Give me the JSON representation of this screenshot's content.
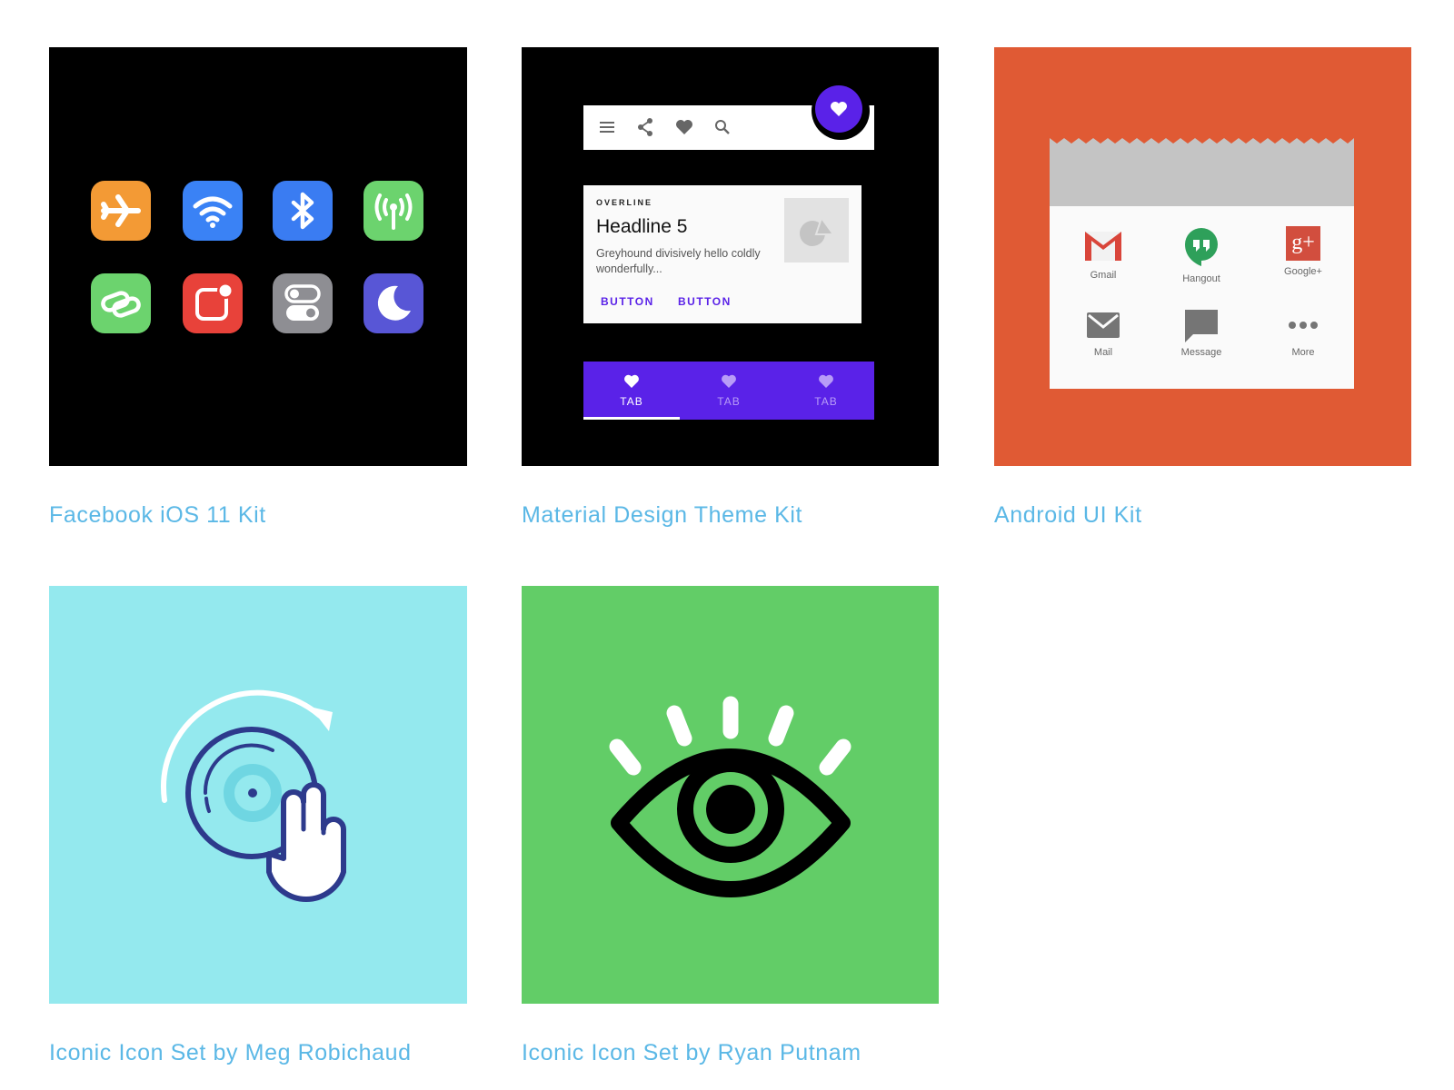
{
  "cards": [
    {
      "title": "Facebook iOS 11 Kit",
      "bg": "#000000"
    },
    {
      "title": "Material Design Theme Kit",
      "bg": "#000000"
    },
    {
      "title": "Android UI Kit",
      "bg": "#e05a34"
    },
    {
      "title": "Iconic Icon Set by Meg Robichaud",
      "bg": "#94e9ee"
    },
    {
      "title": "Iconic Icon Set by Ryan Putnam",
      "bg": "#62cd67"
    }
  ],
  "ios_icons": [
    {
      "name": "airplane-icon",
      "color": "#f39a35"
    },
    {
      "name": "wifi-icon",
      "color": "#3a82f5"
    },
    {
      "name": "bluetooth-icon",
      "color": "#3a7cf2"
    },
    {
      "name": "cellular-antenna-icon",
      "color": "#6cd36e"
    },
    {
      "name": "link-chain-icon",
      "color": "#6cd36e"
    },
    {
      "name": "notification-badge-icon",
      "color": "#e8423a"
    },
    {
      "name": "toggle-settings-icon",
      "color": "#8e8e93"
    },
    {
      "name": "moon-icon",
      "color": "#5856d6"
    }
  ],
  "material": {
    "overline": "OVERLINE",
    "headline": "Headline 5",
    "body": "Greyhound divisively hello coldly wonderfully...",
    "button1": "BUTTON",
    "button2": "BUTTON",
    "tabs": [
      "TAB",
      "TAB",
      "TAB"
    ],
    "accent": "#5a22e8"
  },
  "android": {
    "items": [
      "Gmail",
      "Hangout",
      "Google+",
      "Mail",
      "Message",
      "More"
    ],
    "google_plus_glyph": "g+"
  }
}
